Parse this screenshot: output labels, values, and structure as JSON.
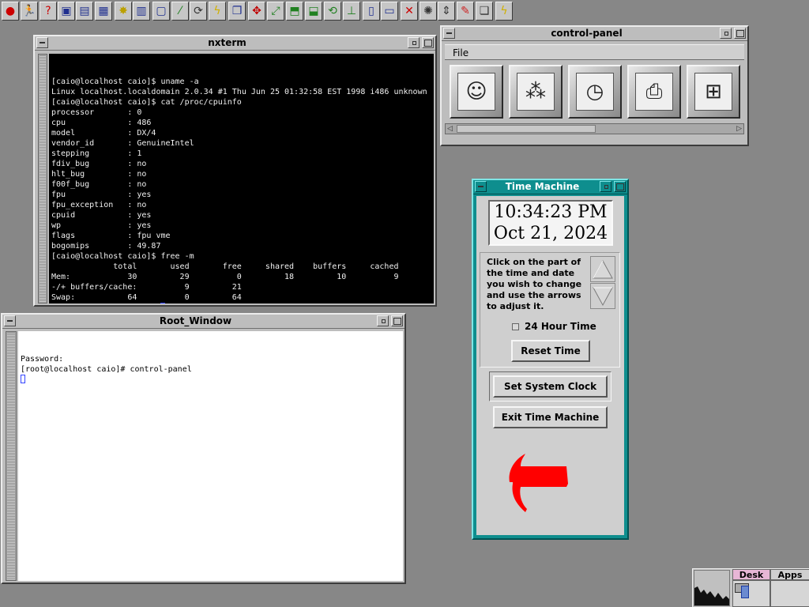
{
  "toolbar": {
    "icons": [
      {
        "name": "redhat-icon",
        "glyph": "●",
        "color": "#cc0000"
      },
      {
        "name": "runner-icon",
        "glyph": "🏃",
        "color": "#333333"
      },
      {
        "name": "help-icon",
        "glyph": "?",
        "color": "#cc0000"
      },
      {
        "name": "window-icon",
        "glyph": "▣",
        "color": "#1f2f8f"
      },
      {
        "name": "desktop-icon",
        "glyph": "▤",
        "color": "#1f2f8f"
      },
      {
        "name": "grid-icon",
        "glyph": "▦",
        "color": "#1f2f8f"
      },
      {
        "name": "sparkle-icon",
        "glyph": "✸",
        "color": "#bba000"
      },
      {
        "name": "table-icon",
        "glyph": "▥",
        "color": "#1f2f8f"
      },
      {
        "name": "frame-icon",
        "glyph": "▢",
        "color": "#1f2f8f"
      },
      {
        "name": "brush-icon",
        "glyph": "⁄",
        "color": "#208020"
      },
      {
        "name": "refresh-icon",
        "glyph": "⟳",
        "color": "#333333"
      },
      {
        "name": "lightning-icon",
        "glyph": "ϟ",
        "color": "#d0b000"
      },
      {
        "name": "windows-stack-icon",
        "glyph": "❐",
        "color": "#1f2f8f"
      },
      {
        "name": "move-icon",
        "glyph": "✥",
        "color": "#c00000"
      },
      {
        "name": "resize-icon",
        "glyph": "⤢",
        "color": "#208020"
      },
      {
        "name": "raise-icon",
        "glyph": "⬒",
        "color": "#208020"
      },
      {
        "name": "lower-icon",
        "glyph": "⬓",
        "color": "#208020"
      },
      {
        "name": "rotate-icon",
        "glyph": "⟲",
        "color": "#208020"
      },
      {
        "name": "stick-icon",
        "glyph": "⊥",
        "color": "#208020"
      },
      {
        "name": "maximize-vertical-icon",
        "glyph": "▯",
        "color": "#1f2f8f"
      },
      {
        "name": "maximize-horizontal-icon",
        "glyph": "▭",
        "color": "#1f2f8f"
      },
      {
        "name": "close-x-icon",
        "glyph": "✕",
        "color": "#cc0000"
      },
      {
        "name": "destroy-icon",
        "glyph": "✺",
        "color": "#333333"
      },
      {
        "name": "updown-icon",
        "glyph": "⇕",
        "color": "#333333"
      },
      {
        "name": "pencil-icon",
        "glyph": "✎",
        "color": "#cc2222"
      },
      {
        "name": "cascade-icon",
        "glyph": "❏",
        "color": "#333333"
      },
      {
        "name": "power-icon",
        "glyph": "ϟ",
        "color": "#d0b000"
      }
    ]
  },
  "nxterm": {
    "title": "nxterm",
    "lines": [
      "[caio@localhost caio]$ uname -a",
      "Linux localhost.localdomain 2.0.34 #1 Thu Jun 25 01:32:58 EST 1998 i486 unknown",
      "[caio@localhost caio]$ cat /proc/cpuinfo",
      "processor       : 0",
      "cpu             : 486",
      "model           : DX/4",
      "vendor_id       : GenuineIntel",
      "stepping        : 1",
      "fdiv_bug        : no",
      "hlt_bug         : no",
      "f00f_bug        : no",
      "fpu             : yes",
      "fpu_exception   : no",
      "cpuid           : yes",
      "wp              : yes",
      "flags           : fpu vme",
      "bogomips        : 49.87",
      "[caio@localhost caio]$ free -m",
      "             total       used       free     shared    buffers     cached",
      "Mem:            30         29          0         18         10          9",
      "-/+ buffers/cache:          9         21",
      "Swap:           64          0         64"
    ],
    "prompt": "[caio@localhost caio]$ "
  },
  "root_window": {
    "title": "Root_Window",
    "lines": [
      "Password:",
      "[root@localhost caio]# control-panel"
    ]
  },
  "control_panel": {
    "title": "control-panel",
    "menu_file": "File",
    "icons": [
      {
        "name": "user-faces-icon",
        "glyph": "☺"
      },
      {
        "name": "system-services-icon",
        "glyph": "⁂"
      },
      {
        "name": "time-clock-icon",
        "glyph": "◷"
      },
      {
        "name": "printer-icon",
        "glyph": "⎙"
      },
      {
        "name": "network-icon",
        "glyph": "⊞"
      }
    ]
  },
  "time_machine": {
    "title": "Time Machine",
    "time": "10:34:23 PM",
    "date": "Oct 21, 2024",
    "instructions": "Click on the part of the time and date you wish to change and use the arrows to adjust it.",
    "hour24_label": "24 Hour Time",
    "hour24_checked": false,
    "reset_label": "Reset Time",
    "set_clock_label": "Set System Clock",
    "exit_label": "Exit Time Machine",
    "arrow_color": "#ff0000"
  },
  "pager": {
    "desk_label": "Desk",
    "apps_label": "Apps"
  }
}
